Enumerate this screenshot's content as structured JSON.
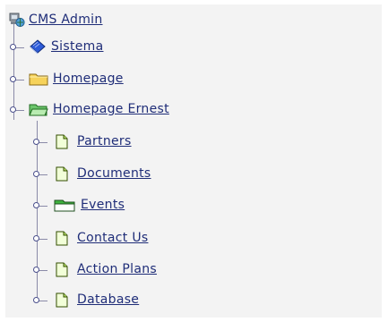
{
  "root": {
    "label": "CMS Admin",
    "icon": "computer-globe-icon"
  },
  "level1": [
    {
      "label": "Sistema",
      "icon": "book-icon"
    },
    {
      "label": "Homepage",
      "icon": "folder-closed-icon"
    },
    {
      "label": "Homepage Ernest",
      "icon": "folder-open-icon"
    }
  ],
  "level2": [
    {
      "label": "Partners",
      "icon": "page-icon"
    },
    {
      "label": "Documents",
      "icon": "page-icon"
    },
    {
      "label": "Events",
      "icon": "green-folder-icon"
    },
    {
      "label": "Contact Us",
      "icon": "page-icon"
    },
    {
      "label": "Action Plans",
      "icon": "page-icon"
    },
    {
      "label": "Database",
      "icon": "page-icon"
    }
  ],
  "colors": {
    "link": "#1f2d78",
    "panel": "#f3f3f3",
    "folder_yellow": "#f6d25a",
    "folder_green": "#3fb43f",
    "book_blue": "#2d5bd8"
  }
}
